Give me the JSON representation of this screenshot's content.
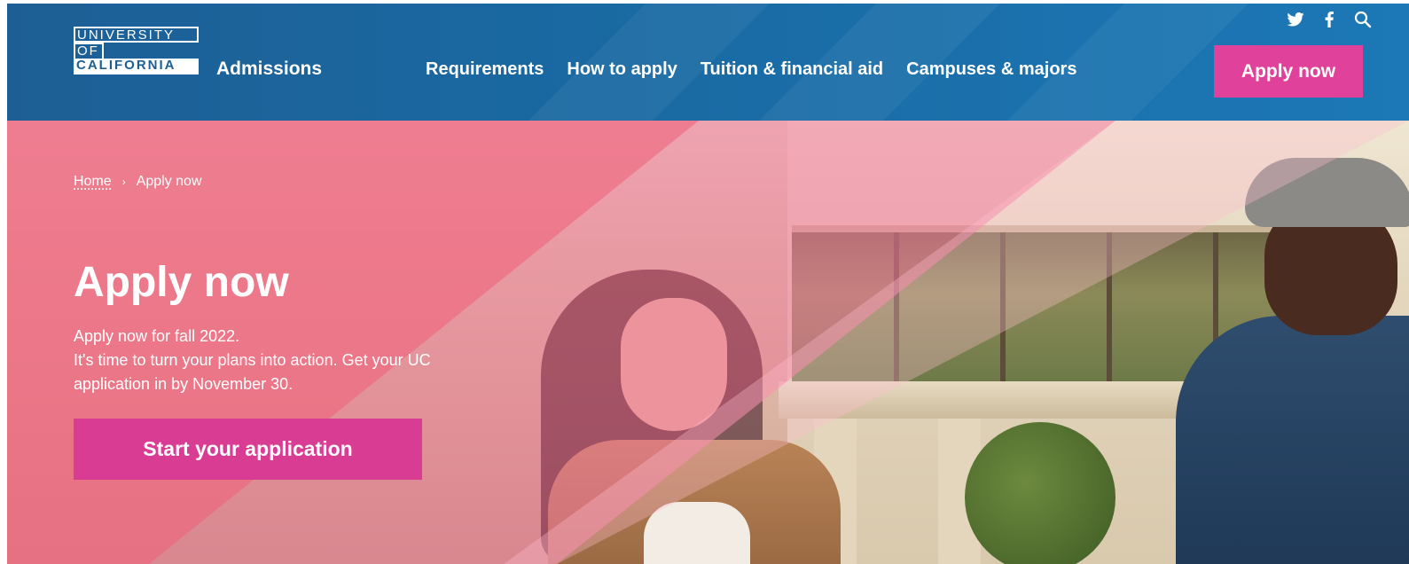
{
  "logo": {
    "line1": "UNIVERSITY",
    "line2": "OF",
    "line3": "CALIFORNIA"
  },
  "header": {
    "brand": "Admissions",
    "nav": [
      {
        "label": "Requirements"
      },
      {
        "label": "How to apply"
      },
      {
        "label": "Tuition & financial aid"
      },
      {
        "label": "Campuses & majors"
      }
    ],
    "apply_button": "Apply now",
    "social": {
      "twitter_icon": "twitter-icon",
      "facebook_icon": "facebook-icon",
      "search_icon": "search-icon"
    },
    "colors": {
      "header_bg": "#1d5f95",
      "apply_bg": "#e0419a"
    }
  },
  "breadcrumb": {
    "home": "Home",
    "separator": "›",
    "current": "Apply now"
  },
  "hero": {
    "title": "Apply now",
    "line1": "Apply now for fall 2022.",
    "line2": "It's time to turn your plans into action. Get your UC",
    "line3": "application in by November 30.",
    "cta": "Start your application",
    "cta_color": "#d93c93"
  }
}
